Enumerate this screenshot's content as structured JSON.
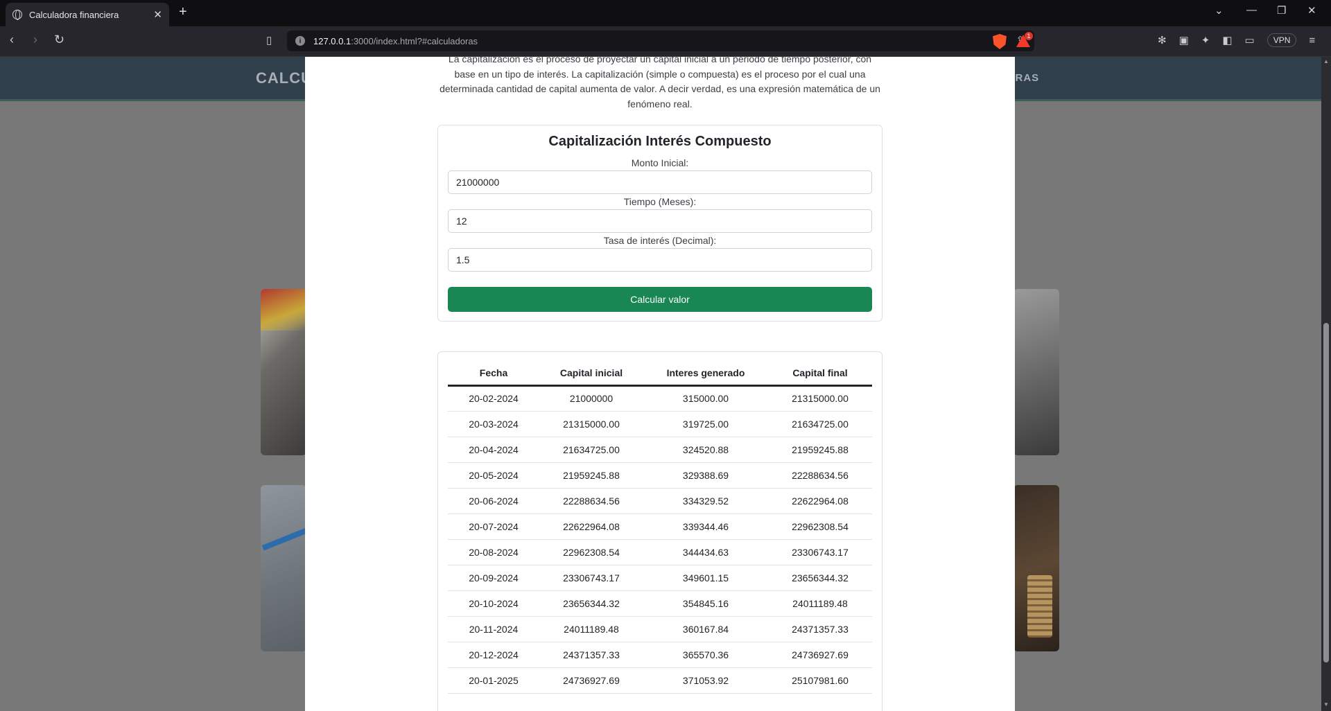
{
  "browser": {
    "tab_title": "Calculadora financiera",
    "url_host": "127.0.0.1",
    "url_rest": ":3000/index.html?#calculadoras",
    "vpn_label": "VPN",
    "notification_count": "1"
  },
  "site_nav": {
    "left_text": "CALCU",
    "right_text": "DORAS"
  },
  "modal": {
    "intro": "La capitalización es el proceso de proyectar un capital inicial a un periodo de tiempo posterior, con base en un tipo de interés. La capitalización (simple o compuesta) es el proceso por el cual una determinada cantidad de capital aumenta de valor. A decir verdad, es una expresión matemática de un fenómeno real.",
    "title": "Capitalización Interés Compuesto",
    "monto_label": "Monto Inicial:",
    "monto_value": "21000000",
    "tiempo_label": "Tiempo (Meses):",
    "tiempo_value": "12",
    "tasa_label": "Tasa de interés (Decimal):",
    "tasa_value": "1.5",
    "button_label": "Calcular valor"
  },
  "table": {
    "headers": [
      "Fecha",
      "Capital inicial",
      "Interes generado",
      "Capital final"
    ],
    "rows": [
      [
        "20-02-2024",
        "21000000",
        "315000.00",
        "21315000.00"
      ],
      [
        "20-03-2024",
        "21315000.00",
        "319725.00",
        "21634725.00"
      ],
      [
        "20-04-2024",
        "21634725.00",
        "324520.88",
        "21959245.88"
      ],
      [
        "20-05-2024",
        "21959245.88",
        "329388.69",
        "22288634.56"
      ],
      [
        "20-06-2024",
        "22288634.56",
        "334329.52",
        "22622964.08"
      ],
      [
        "20-07-2024",
        "22622964.08",
        "339344.46",
        "22962308.54"
      ],
      [
        "20-08-2024",
        "22962308.54",
        "344434.63",
        "23306743.17"
      ],
      [
        "20-09-2024",
        "23306743.17",
        "349601.15",
        "23656344.32"
      ],
      [
        "20-10-2024",
        "23656344.32",
        "354845.16",
        "24011189.48"
      ],
      [
        "20-11-2024",
        "24011189.48",
        "360167.84",
        "24371357.33"
      ],
      [
        "20-12-2024",
        "24371357.33",
        "365570.36",
        "24736927.69"
      ],
      [
        "20-01-2025",
        "24736927.69",
        "371053.92",
        "25107981.60"
      ]
    ]
  }
}
